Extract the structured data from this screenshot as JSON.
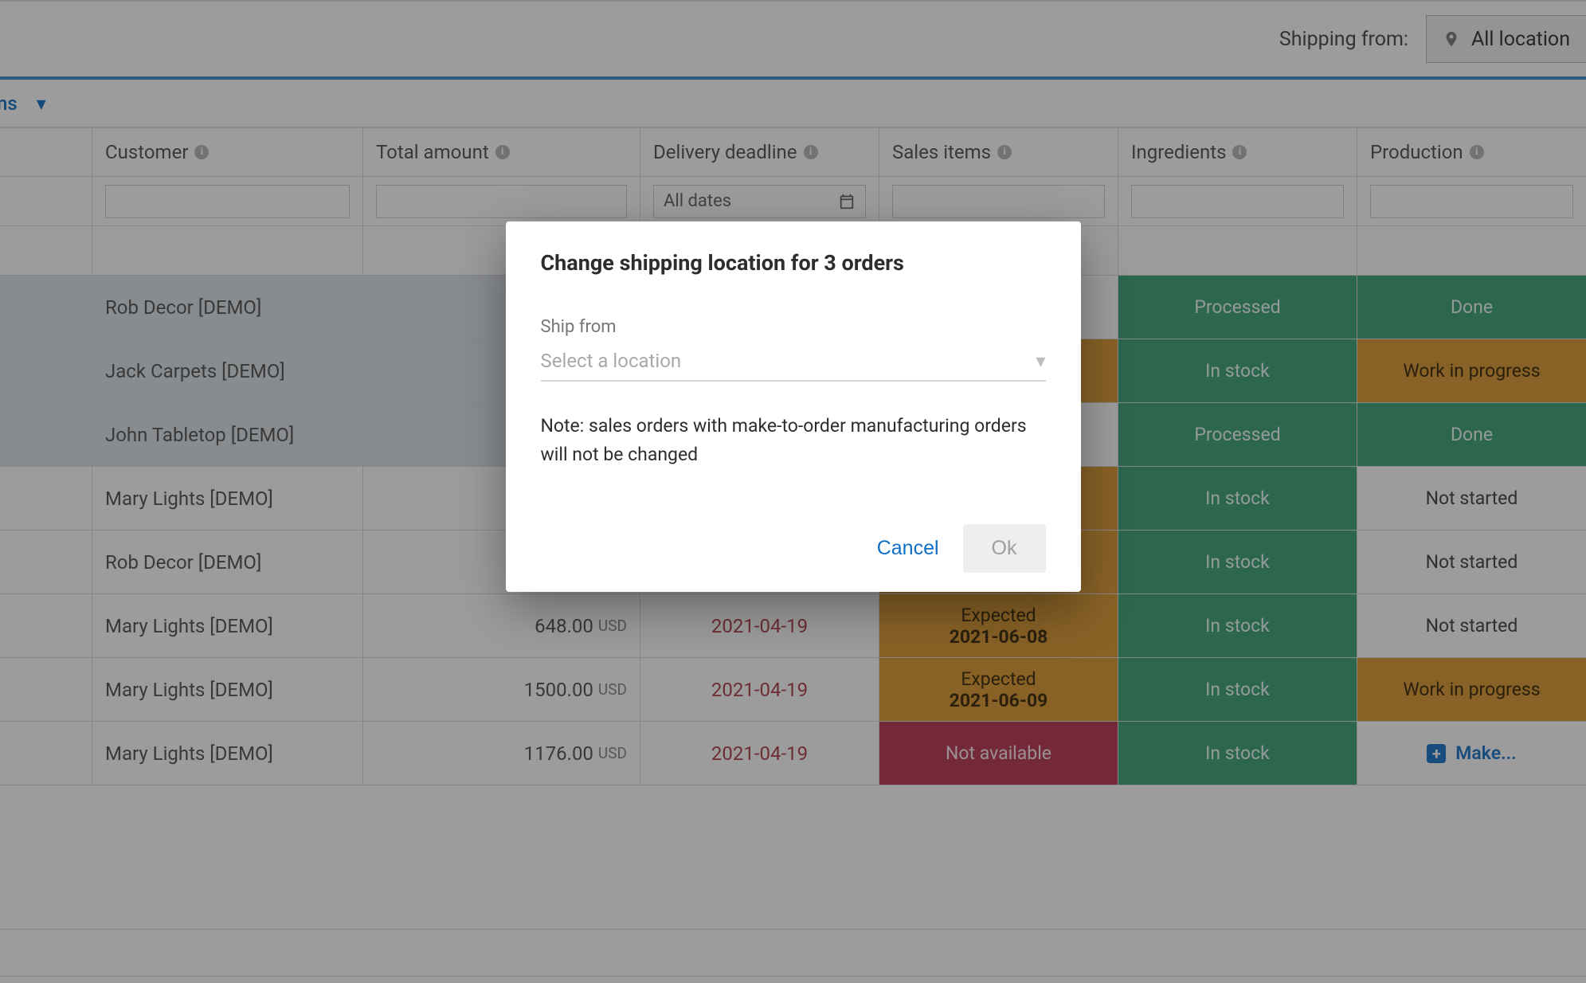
{
  "topbar": {
    "shipping_from_label": "Shipping from:",
    "location_selected": "All location"
  },
  "secondbar": {
    "item_suffix": "ns"
  },
  "columns": {
    "customer": "Customer",
    "total_amount": "Total amount",
    "delivery_deadline": "Delivery deadline",
    "sales_items": "Sales items",
    "ingredients": "Ingredients",
    "production": "Production"
  },
  "filters": {
    "date_placeholder": "All dates"
  },
  "status": {
    "processed": "Processed",
    "done": "Done",
    "in_stock": "In stock",
    "work_in_progress": "Work in progress",
    "not_started": "Not started",
    "not_available": "Not available",
    "expected": "Expected",
    "make": "Make..."
  },
  "rows": [
    {
      "selected": true,
      "customer": "Rob Decor [DEMO]",
      "amount": "",
      "currency": "",
      "deadline": "",
      "sales_items": {
        "type": "hidden"
      },
      "ingredients": {
        "type": "green",
        "text": "Processed"
      },
      "production": {
        "type": "green",
        "text": "Done"
      }
    },
    {
      "selected": true,
      "customer": "Jack Carpets [DEMO]",
      "amount": "",
      "currency": "",
      "deadline": "",
      "sales_items": {
        "type": "amber-hidden"
      },
      "ingredients": {
        "type": "green",
        "text": "In stock"
      },
      "production": {
        "type": "amber",
        "text": "Work in progress"
      }
    },
    {
      "selected": true,
      "customer": "John Tabletop [DEMO]",
      "amount": "",
      "currency": "",
      "deadline": "",
      "sales_items": {
        "type": "hidden"
      },
      "ingredients": {
        "type": "green",
        "text": "Processed"
      },
      "production": {
        "type": "green",
        "text": "Done"
      }
    },
    {
      "selected": false,
      "customer": "Mary Lights [DEMO]",
      "amount": "",
      "currency": "",
      "deadline": "",
      "sales_items": {
        "type": "amber-hidden"
      },
      "ingredients": {
        "type": "green",
        "text": "In stock"
      },
      "production": {
        "type": "white",
        "text": "Not started"
      }
    },
    {
      "selected": false,
      "customer": "Rob Decor [DEMO]",
      "amount": "",
      "currency": "",
      "deadline": "",
      "sales_items": {
        "type": "amber-hidden"
      },
      "ingredients": {
        "type": "green",
        "text": "In stock"
      },
      "production": {
        "type": "white",
        "text": "Not started"
      }
    },
    {
      "selected": false,
      "customer": "Mary Lights [DEMO]",
      "amount": "648.00",
      "currency": "USD",
      "deadline": "2021-04-19",
      "sales_items": {
        "type": "amber",
        "text": "Expected",
        "sub": "2021-06-08"
      },
      "ingredients": {
        "type": "green",
        "text": "In stock"
      },
      "production": {
        "type": "white",
        "text": "Not started"
      }
    },
    {
      "selected": false,
      "customer": "Mary Lights [DEMO]",
      "amount": "1500.00",
      "currency": "USD",
      "deadline": "2021-04-19",
      "sales_items": {
        "type": "amber",
        "text": "Expected",
        "sub": "2021-06-09"
      },
      "ingredients": {
        "type": "green",
        "text": "In stock"
      },
      "production": {
        "type": "amber",
        "text": "Work in progress"
      }
    },
    {
      "selected": false,
      "customer": "Mary Lights [DEMO]",
      "amount": "1176.00",
      "currency": "USD",
      "deadline": "2021-04-19",
      "sales_items": {
        "type": "red",
        "text": "Not available"
      },
      "ingredients": {
        "type": "green",
        "text": "In stock"
      },
      "production": {
        "type": "make",
        "text": "Make..."
      }
    }
  ],
  "modal": {
    "title": "Change shipping location for 3 orders",
    "field_label": "Ship from",
    "select_placeholder": "Select a location",
    "note": "Note: sales orders with make-to-order manufacturing orders will not be changed",
    "cancel": "Cancel",
    "ok": "Ok"
  }
}
